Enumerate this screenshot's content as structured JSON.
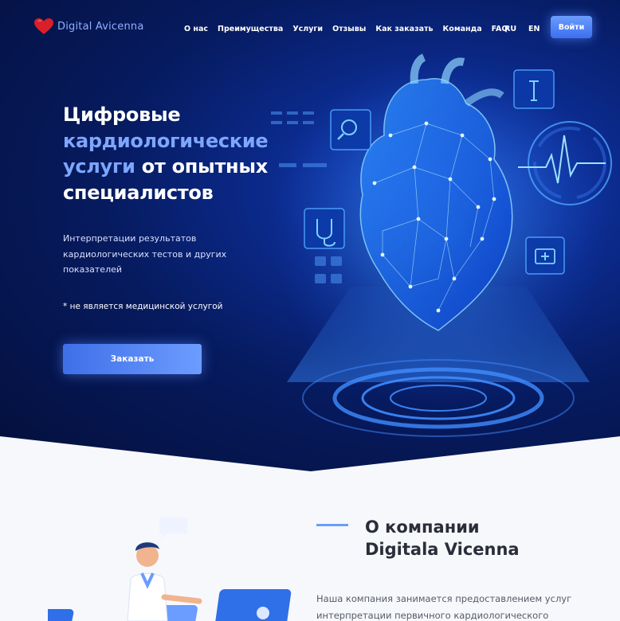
{
  "brand": {
    "name": "Digital Avicenna",
    "icon": "heart-icon"
  },
  "nav": {
    "items": [
      "О нас",
      "Преимущества",
      "Услуги",
      "Отзывы",
      "Как заказать",
      "Команда",
      "FAQ"
    ],
    "lang_ru": "RU",
    "lang_en": "EN",
    "login_label": "Войти"
  },
  "hero": {
    "title_1": "Цифровые",
    "title_2": "кардиологические",
    "title_3": "услуги",
    "title_4": "от опытных",
    "title_5": "специалистов",
    "subtitle": "Интерпретации результатов кардиологических тестов и других показателей",
    "note": "* не является медицинской услугой",
    "order_label": "Заказать"
  },
  "about": {
    "title_1": "О компании",
    "title_2": "Digitala Vicenna",
    "text": "Наша компания занимается предоставлением услуг интерпретации первичного кардиологического"
  },
  "colors": {
    "accent": "#6b9cff",
    "hero_bg": "#061a5e",
    "highlight": "#7ea6ff"
  }
}
